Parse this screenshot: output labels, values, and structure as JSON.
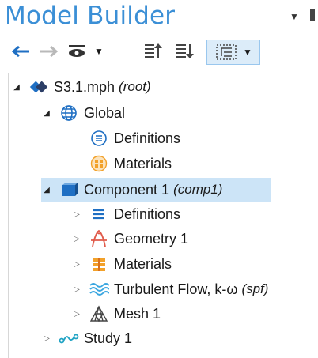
{
  "header": {
    "title": "Model Builder"
  },
  "toolbar": {
    "items": [
      {
        "icon": "arrow-left-icon"
      },
      {
        "icon": "arrow-right-icon"
      },
      {
        "icon": "show-eye-icon"
      },
      {
        "icon": "dropdown-icon"
      },
      {
        "icon": "collapse-all-icon"
      },
      {
        "icon": "expand-all-icon"
      },
      {
        "icon": "model-tree-view-icon"
      }
    ]
  },
  "tree": {
    "root": {
      "label": "S3.1.mph",
      "tag": "(root)"
    },
    "global": {
      "label": "Global"
    },
    "global_definitions": {
      "label": "Definitions"
    },
    "global_materials": {
      "label": "Materials"
    },
    "component": {
      "label": "Component 1",
      "tag": "(comp1)"
    },
    "comp_definitions": {
      "label": "Definitions"
    },
    "geometry": {
      "label": "Geometry 1"
    },
    "comp_materials": {
      "label": "Materials"
    },
    "turbulent_flow": {
      "label": "Turbulent Flow, k-ω",
      "tag": "(spf)"
    },
    "mesh": {
      "label": "Mesh 1"
    },
    "study": {
      "label": "Study 1"
    }
  },
  "colors": {
    "title": "#3b8fd6",
    "selection": "#cce4f7",
    "accent_blue": "#1f6fc3",
    "materials_orange": "#f2a12a"
  }
}
